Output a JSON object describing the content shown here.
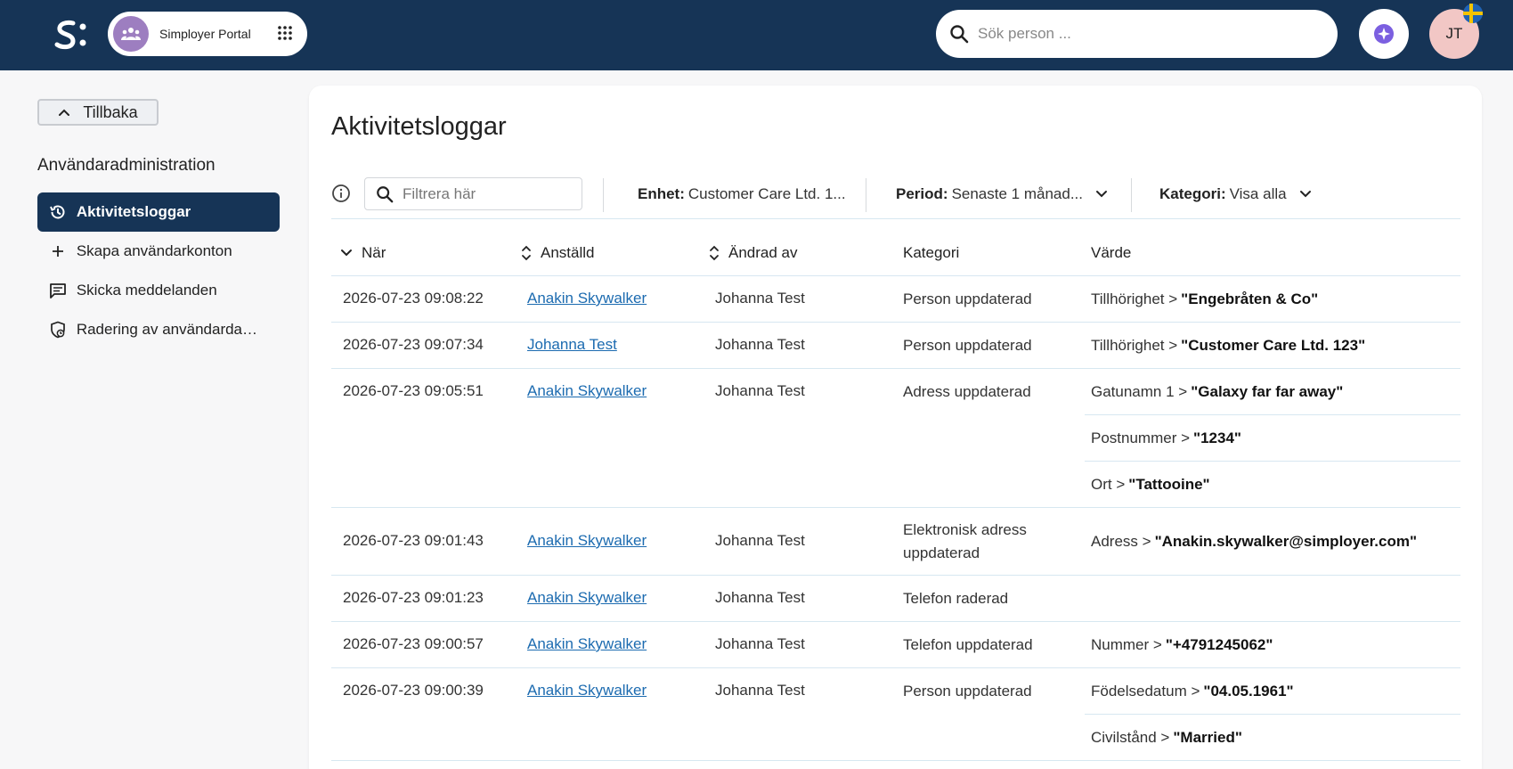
{
  "header": {
    "portal_name": "Simployer Portal",
    "search_placeholder": "Sök person ...",
    "user_initials": "JT"
  },
  "sidebar": {
    "back_label": "Tillbaka",
    "section_title": "Användaradministration",
    "items": [
      {
        "label": "Aktivitetsloggar",
        "icon": "history-icon",
        "active": true
      },
      {
        "label": "Skapa användarkonton",
        "icon": "plus-icon",
        "active": false
      },
      {
        "label": "Skicka meddelanden",
        "icon": "message-icon",
        "active": false
      },
      {
        "label": "Radering av användarda…",
        "icon": "shield-clock-icon",
        "active": false
      }
    ]
  },
  "main": {
    "title": "Aktivitetsloggar",
    "filter_placeholder": "Filtrera här",
    "filters": {
      "enhet_label": "Enhet:",
      "enhet_value": "Customer Care Ltd. 1...",
      "period_label": "Period:",
      "period_value": "Senaste 1 månad...",
      "kategori_label": "Kategori:",
      "kategori_value": "Visa alla"
    },
    "columns": {
      "when": "När",
      "employee": "Anställd",
      "changed_by": "Ändrad av",
      "category": "Kategori",
      "value": "Värde"
    },
    "rows": [
      {
        "when": "2026-07-23 09:08:22",
        "employee": "Anakin Skywalker",
        "changed_by": "Johanna Test",
        "category": "Person uppdaterad",
        "values": [
          {
            "field": "Tillhörighet >",
            "value": "\"Engebråten & Co\""
          }
        ]
      },
      {
        "when": "2026-07-23 09:07:34",
        "employee": "Johanna Test",
        "changed_by": "Johanna Test",
        "category": "Person uppdaterad",
        "values": [
          {
            "field": "Tillhörighet >",
            "value": "\"Customer Care Ltd. 123\""
          }
        ]
      },
      {
        "when": "2026-07-23 09:05:51",
        "employee": "Anakin Skywalker",
        "changed_by": "Johanna Test",
        "category": "Adress uppdaterad",
        "values": [
          {
            "field": "Gatunamn 1 >",
            "value": "\"Galaxy far far away\""
          },
          {
            "field": "Postnummer >",
            "value": "\"1234\""
          },
          {
            "field": "Ort >",
            "value": "\"Tattooine\""
          }
        ]
      },
      {
        "when": "2026-07-23 09:01:43",
        "employee": "Anakin Skywalker",
        "changed_by": "Johanna Test",
        "category": "Elektronisk adress uppdaterad",
        "values": [
          {
            "field": "Adress >",
            "value": "\"Anakin.skywalker@simployer.com\""
          }
        ]
      },
      {
        "when": "2026-07-23 09:01:23",
        "employee": "Anakin Skywalker",
        "changed_by": "Johanna Test",
        "category": "Telefon raderad",
        "values": []
      },
      {
        "when": "2026-07-23 09:00:57",
        "employee": "Anakin Skywalker",
        "changed_by": "Johanna Test",
        "category": "Telefon uppdaterad",
        "values": [
          {
            "field": "Nummer >",
            "value": "\"+4791245062\""
          }
        ]
      },
      {
        "when": "2026-07-23 09:00:39",
        "employee": "Anakin Skywalker",
        "changed_by": "Johanna Test",
        "category": "Person uppdaterad",
        "values": [
          {
            "field": "Födelsedatum >",
            "value": "\"04.05.1961\""
          },
          {
            "field": "Civilstånd >",
            "value": "\"Married\""
          }
        ]
      }
    ]
  },
  "colors": {
    "topbar": "#163456",
    "accent_link": "#1c6bb0",
    "avatar_bg": "#f2c7c5",
    "portal_icon_bg": "#9d7ec0"
  }
}
